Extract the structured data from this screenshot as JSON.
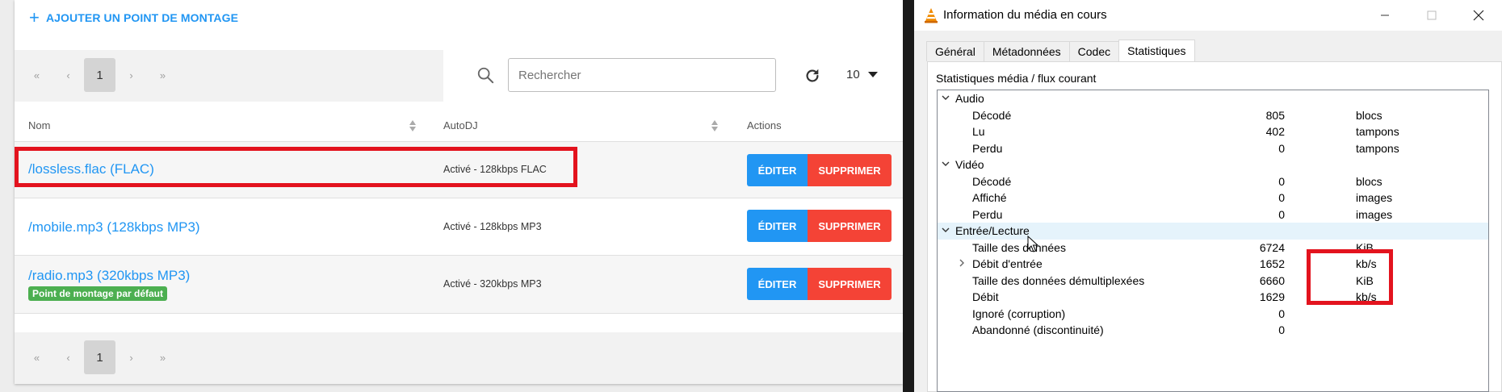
{
  "mounts_page": {
    "add_mount_label": "AJOUTER UN POINT DE MONTAGE",
    "pagination": {
      "first": "«",
      "prev": "‹",
      "current": "1",
      "next": "›",
      "last": "»"
    },
    "search": {
      "placeholder": "Rechercher",
      "value": ""
    },
    "per_page": "10",
    "columns": {
      "name": "Nom",
      "autodj": "AutoDJ",
      "actions": "Actions"
    },
    "rows": [
      {
        "name": "/lossless.flac (FLAC)",
        "autodj": "Activé - 128kbps FLAC",
        "badge": ""
      },
      {
        "name": "/mobile.mp3 (128kbps MP3)",
        "autodj": "Activé - 128kbps MP3",
        "badge": ""
      },
      {
        "name": "/radio.mp3 (320kbps MP3)",
        "autodj": "Activé - 320kbps MP3",
        "badge": "Point de montage par défaut"
      }
    ],
    "edit_label": "ÉDITER",
    "delete_label": "SUPPRIMER",
    "colors": {
      "accent": "#2196f3",
      "danger": "#f44336",
      "success": "#4caf50",
      "highlight": "#e3131e"
    }
  },
  "vlc_dialog": {
    "title": "Information du média en cours",
    "tabs": [
      "Général",
      "Métadonnées",
      "Codec",
      "Statistiques"
    ],
    "active_tab": "Statistiques",
    "heading": "Statistiques média / flux courant",
    "tree": [
      {
        "label": "Audio",
        "value": "",
        "unit": ""
      },
      {
        "label": "Décodé",
        "value": "805",
        "unit": "blocs"
      },
      {
        "label": "Lu",
        "value": "402",
        "unit": "tampons"
      },
      {
        "label": "Perdu",
        "value": "0",
        "unit": "tampons"
      },
      {
        "label": "Vidéo",
        "value": "",
        "unit": ""
      },
      {
        "label": "Décodé",
        "value": "0",
        "unit": "blocs"
      },
      {
        "label": "Affiché",
        "value": "0",
        "unit": "images"
      },
      {
        "label": "Perdu",
        "value": "0",
        "unit": "images"
      },
      {
        "label": "Entrée/Lecture",
        "value": "",
        "unit": ""
      },
      {
        "label": "Taille des données",
        "value": "6724",
        "unit": "KiB"
      },
      {
        "label": "Débit d'entrée",
        "value": "1652",
        "unit": "kb/s"
      },
      {
        "label": "Taille des données démultiplexées",
        "value": "6660",
        "unit": "KiB"
      },
      {
        "label": "Débit",
        "value": "1629",
        "unit": "kb/s"
      },
      {
        "label": "Ignoré (corruption)",
        "value": "0",
        "unit": ""
      },
      {
        "label": "Abandonné (discontinuité)",
        "value": "0",
        "unit": ""
      }
    ]
  }
}
